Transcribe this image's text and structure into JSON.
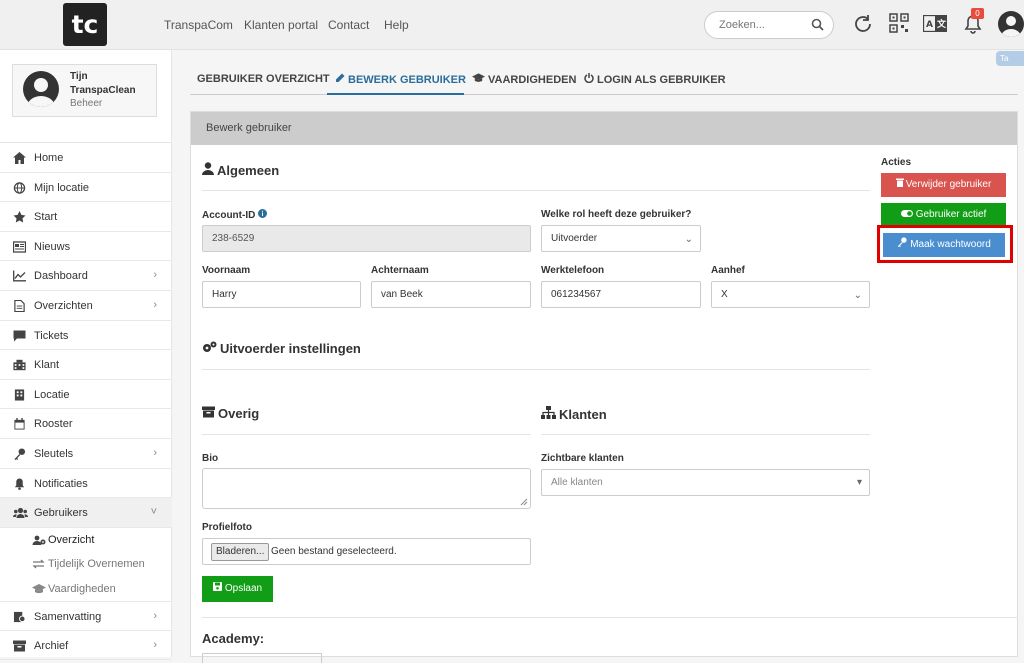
{
  "topbar": {
    "logo": "tc",
    "nav": [
      "TranspaCom",
      "Klanten portal",
      "Contact",
      "Help"
    ],
    "search_placeholder": "Zoeken...",
    "notification_count": "0",
    "corner_tab": "Ta"
  },
  "sidebar": {
    "user": {
      "first": "Tijn",
      "last": "TranspaClean",
      "role": "Beheer"
    },
    "items": [
      {
        "label": "Home",
        "icon": "home-icon",
        "chevron": false
      },
      {
        "label": "Mijn locatie",
        "icon": "globe-icon",
        "chevron": false
      },
      {
        "label": "Start",
        "icon": "star-icon",
        "chevron": false
      },
      {
        "label": "Nieuws",
        "icon": "newspaper-icon",
        "chevron": false
      },
      {
        "label": "Dashboard",
        "icon": "chart-icon",
        "chevron": true
      },
      {
        "label": "Overzichten",
        "icon": "file-icon",
        "chevron": true
      },
      {
        "label": "Tickets",
        "icon": "comment-icon",
        "chevron": false
      },
      {
        "label": "Klant",
        "icon": "building-icon",
        "chevron": false
      },
      {
        "label": "Locatie",
        "icon": "location-building-icon",
        "chevron": false
      },
      {
        "label": "Rooster",
        "icon": "calendar-icon",
        "chevron": false
      },
      {
        "label": "Sleutels",
        "icon": "key-icon",
        "chevron": true
      },
      {
        "label": "Notificaties",
        "icon": "bell-icon",
        "chevron": false
      },
      {
        "label": "Gebruikers",
        "icon": "users-icon",
        "chevron": true
      }
    ],
    "subitems": [
      {
        "label": "Overzicht",
        "icon": "users-cog-icon"
      },
      {
        "label": "Tijdelijk Overnemen",
        "icon": "exchange-icon"
      },
      {
        "label": "Vaardigheden",
        "icon": "graduation-cap-icon"
      }
    ],
    "items_after": [
      {
        "label": "Samenvatting",
        "icon": "summary-icon",
        "chevron": true
      },
      {
        "label": "Archief",
        "icon": "archive-icon",
        "chevron": true
      }
    ]
  },
  "tabs": [
    {
      "label": "GEBRUIKER OVERZICHT",
      "icon": ""
    },
    {
      "label": "BEWERK GEBRUIKER",
      "icon": "pencil-icon"
    },
    {
      "label": "VAARDIGHEDEN",
      "icon": "graduation-cap-icon"
    },
    {
      "label": "LOGIN ALS GEBRUIKER",
      "icon": "power-icon"
    }
  ],
  "panel": {
    "title": "Bewerk gebruiker",
    "section_general": "Algemeen",
    "account_id_label": "Account-ID",
    "account_id_value": "238-6529",
    "role_label": "Welke rol heeft deze gebruiker?",
    "role_value": "Uitvoerder",
    "first_name_label": "Voornaam",
    "first_name_value": "Harry",
    "last_name_label": "Achternaam",
    "last_name_value": "van Beek",
    "phone_label": "Werktelefoon",
    "phone_value": "061234567",
    "salutation_label": "Aanhef",
    "salutation_value": "X",
    "section_exec": "Uitvoerder instellingen",
    "section_other": "Overig",
    "section_clients": "Klanten",
    "bio_label": "Bio",
    "visible_clients_label": "Zichtbare klanten",
    "visible_clients_value": "Alle klanten",
    "photo_label": "Profielfoto",
    "browse_button": "Bladeren...",
    "no_file": "Geen bestand geselecteerd.",
    "save_button": "Opslaan",
    "section_academy": "Academy:"
  },
  "actions": {
    "title": "Acties",
    "delete": "Verwijder gebruiker",
    "active": "Gebruiker actief",
    "password": "Maak wachtwoord"
  },
  "colors": {
    "accent": "#2a6d9c",
    "danger": "#d9534f",
    "success": "#119e16",
    "info": "#4a8ed0",
    "highlight": "#e00000"
  }
}
